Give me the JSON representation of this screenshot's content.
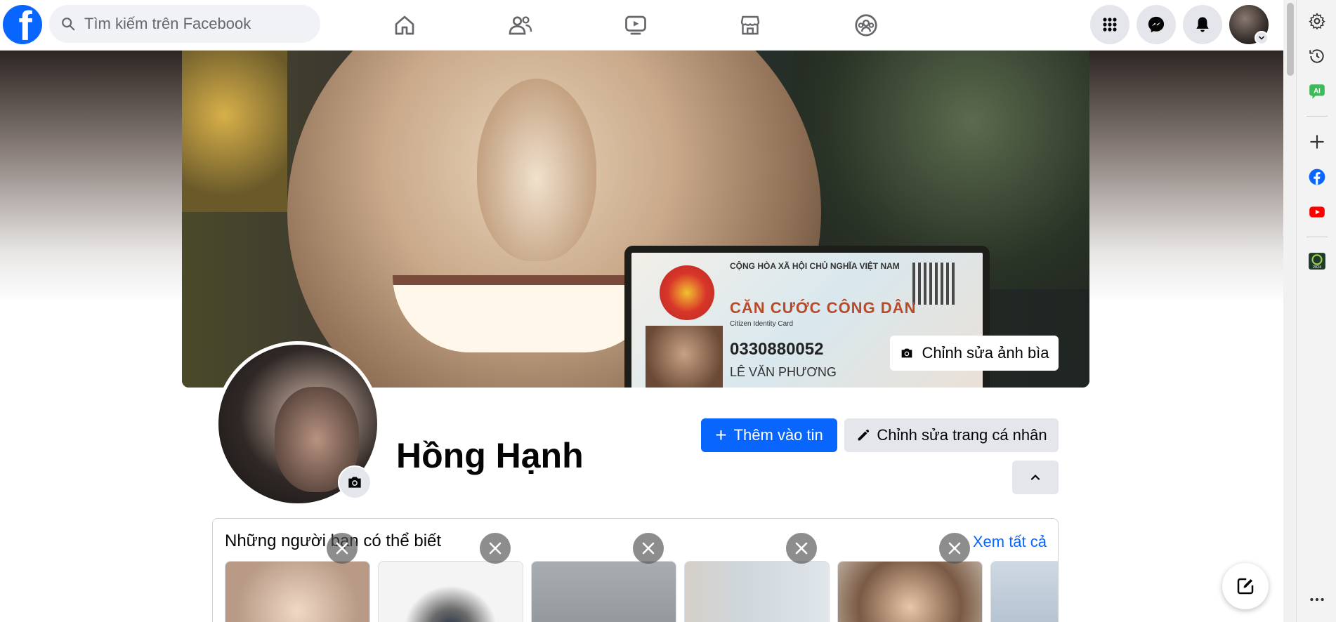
{
  "topbar": {
    "logo_letter": "f",
    "search_placeholder": "Tìm kiếm trên Facebook",
    "nav_icons": [
      "home-icon",
      "friends-icon",
      "video-icon",
      "marketplace-icon",
      "groups-icon"
    ],
    "right_icons": [
      "menu-grid-icon",
      "messenger-icon",
      "notifications-icon"
    ]
  },
  "cover": {
    "edit_label": "Chỉnh sửa ảnh bìa",
    "card_heading": "CỘNG HÒA XÃ HỘI CHỦ NGHĨA VIỆT NAM",
    "card_title": "CĂN CƯỚC CÔNG DÂN",
    "card_subtitle": "Citizen Identity Card",
    "card_number": "0330880052",
    "card_name": "LÊ VĂN PHƯƠNG"
  },
  "profile": {
    "name": "Hồng Hạnh",
    "add_story_label": "Thêm vào tin",
    "edit_profile_label": "Chỉnh sửa trang cá nhân"
  },
  "pymk": {
    "title": "Những người bạn có thể biết",
    "see_all": "Xem tất cả",
    "card_colors": [
      "#d9c6b4",
      "#f4f4f4",
      "#9aa0a4",
      "#cfd6dc",
      "#b8a898",
      "#cdd8e2"
    ]
  },
  "edge_sidebar": {
    "icons": [
      "settings-icon",
      "history-icon",
      "ai-icon",
      "add-icon",
      "facebook-icon",
      "youtube-icon",
      "app-2024-icon",
      "more-icon"
    ]
  },
  "colors": {
    "brand": "#0866ff",
    "secondary_btn": "#e4e6eb"
  }
}
